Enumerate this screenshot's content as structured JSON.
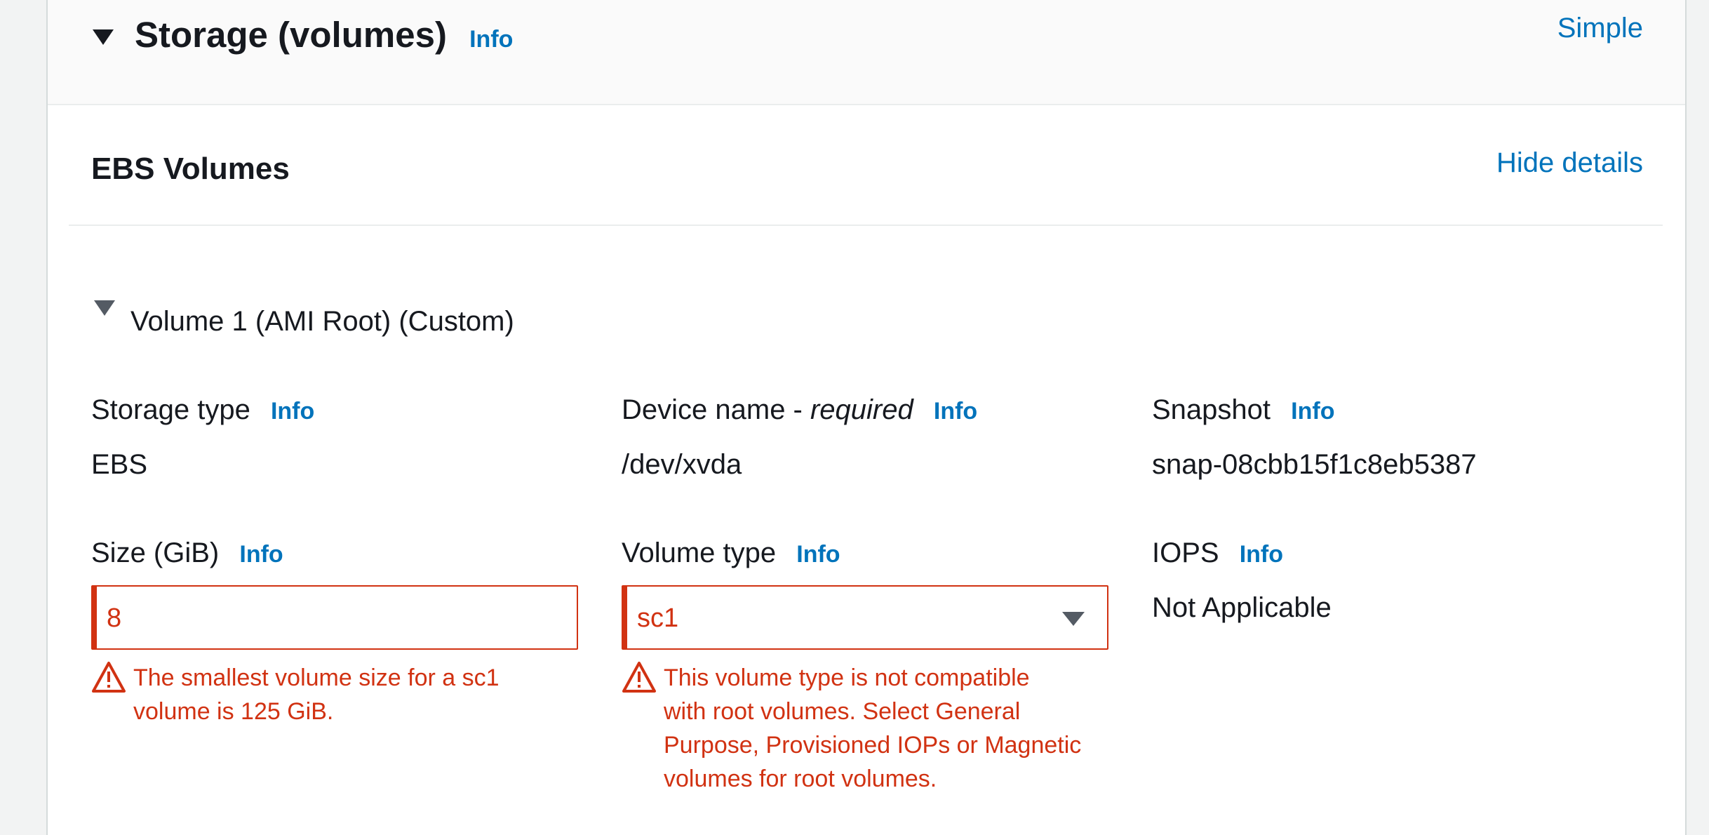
{
  "section": {
    "title": "Storage (volumes)",
    "info_label": "Info",
    "mode_link": "Simple"
  },
  "ebs": {
    "title": "EBS Volumes",
    "toggle_link": "Hide details"
  },
  "volume": {
    "title": "Volume 1 (AMI Root) (Custom)",
    "storage_type": {
      "label": "Storage type",
      "info": "Info",
      "value": "EBS"
    },
    "device_name": {
      "label": "Device name - ",
      "label_suffix": "required",
      "info": "Info",
      "value": "/dev/xvda"
    },
    "snapshot": {
      "label": "Snapshot",
      "info": "Info",
      "value": "snap-08cbb15f1c8eb5387"
    },
    "size": {
      "label": "Size (GiB)",
      "info": "Info",
      "value": "8",
      "error_lines": [
        "The smallest volume size for a sc1",
        "volume is 125 GiB."
      ]
    },
    "volume_type": {
      "label": "Volume type",
      "info": "Info",
      "value": "sc1",
      "error_lines": [
        "This volume type is not compatible",
        "with root volumes. Select General",
        "Purpose, Provisioned IOPs or Magnetic",
        "volumes for root volumes."
      ]
    },
    "iops": {
      "label": "IOPS",
      "info": "Info",
      "value": "Not Applicable"
    }
  },
  "colors": {
    "link": "#0073bb",
    "error": "#d13212",
    "text": "#16191f"
  },
  "icons": {
    "section_toggle": "caret-down-icon",
    "volume_toggle": "caret-down-icon",
    "select_toggle": "chevron-down-icon",
    "error": "warning-triangle-icon"
  }
}
